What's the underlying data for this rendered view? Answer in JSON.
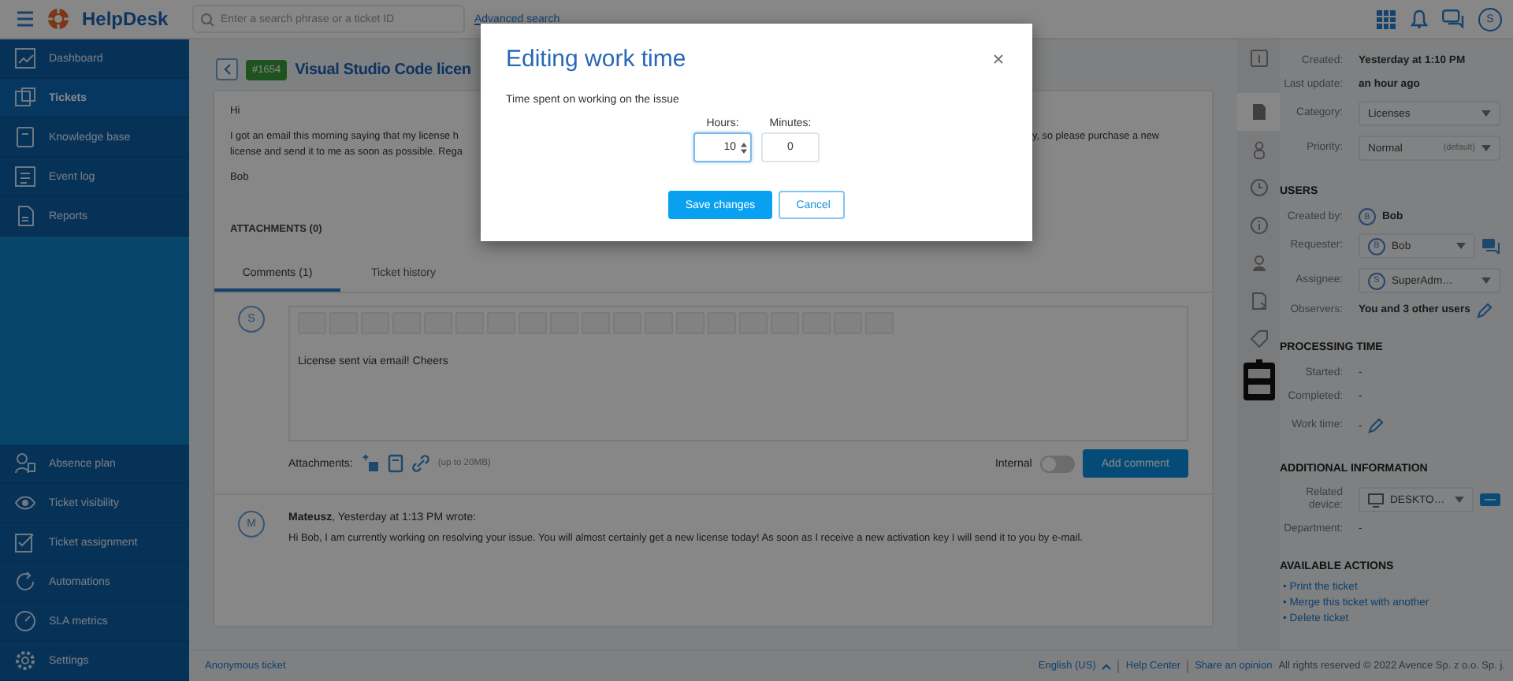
{
  "topbar": {
    "app_name": "HelpDesk",
    "search": {
      "placeholder": "Enter a search phrase or a ticket ID"
    },
    "advanced_search": "Advanced search",
    "avatar": "S"
  },
  "sidebar": {
    "items": [
      {
        "label": "Dashboard",
        "selected": false
      },
      {
        "label": "Tickets",
        "selected": true
      },
      {
        "label": "Knowledge base",
        "selected": false
      },
      {
        "label": "Event log",
        "selected": false
      },
      {
        "label": "Reports",
        "selected": false
      }
    ],
    "bottom_items": [
      {
        "label": "Absence plan",
        "selected": false
      },
      {
        "label": "Ticket visibility",
        "selected": false
      },
      {
        "label": "Ticket assignment",
        "selected": false
      },
      {
        "label": "Automations",
        "selected": false
      },
      {
        "label": "SLA metrics",
        "selected": false
      },
      {
        "label": "Settings",
        "selected": false
      }
    ]
  },
  "ticket": {
    "number": "#1654",
    "title": "Visual Studio Code licen",
    "greeting": "Hi",
    "body_lines": [
      {
        "left": "I got an email this morning saying that my license h",
        "right": "y, so please purchase a new"
      },
      {
        "left": "license and send it to me as soon as possible. Rega"
      }
    ],
    "signature": "Bob",
    "attachments_heading": "ATTACHMENTS (0)",
    "tabs": [
      {
        "label": "Comments (1)",
        "selected": true
      },
      {
        "label": "Ticket history",
        "selected": false
      }
    ],
    "editor": {
      "avatar": "S",
      "text": "License sent via email! Cheers"
    },
    "attachments_label": "Attachments:",
    "attachments_limit": "(up to 20MB)",
    "internal": {
      "label": "Internal",
      "on": false
    },
    "add_comment": "Add comment",
    "comments": [
      {
        "avatar": "M",
        "header": "**Mateusz**, Yesterday at 1:13 PM wrote:",
        "text": "Hi Bob, I am currently working on resolving your issue. You will almost certainly get a new license today! As soon as I receive a new activation key I will send it to you by e-mail."
      }
    ]
  },
  "details": {
    "sections": [
      {
        "fields": [
          {
            "label": "Created:",
            "kind": "info",
            "value": "Yesterday at 1:10 PM"
          },
          {
            "label": "Last update:",
            "kind": "info",
            "value": "an hour ago"
          },
          {
            "label": "Category:",
            "kind": "select",
            "value": "Licenses"
          },
          {
            "label": "Priority:",
            "kind": "select",
            "value": "Normal",
            "note": "(default)"
          }
        ]
      },
      {
        "title": "USERS",
        "fields": [
          {
            "label": "Created by:",
            "kind": "user",
            "avatar": "B",
            "value": "Bob"
          },
          {
            "label": "Requester:",
            "kind": "user_select",
            "avatar": "B",
            "value": "Bob",
            "action": {
              "kind": "chat"
            }
          },
          {
            "label": "Assignee:",
            "kind": "user_select",
            "avatar": "S",
            "value": "SuperAdm…"
          },
          {
            "label": "Observers:",
            "kind": "info",
            "value": "You and 3 other users",
            "action": {
              "kind": "edit"
            }
          }
        ]
      },
      {
        "title": "PROCESSING TIME",
        "fields": [
          {
            "label": "Started:",
            "kind": "text",
            "value": "-"
          },
          {
            "label": "Completed:",
            "kind": "text",
            "value": "-"
          },
          {
            "label": "Work time:",
            "kind": "text",
            "value": "-",
            "action": {
              "kind": "edit"
            }
          }
        ]
      },
      {
        "title": "ADDITIONAL INFORMATION",
        "fields": [
          {
            "label": "Related device:",
            "kind": "device_select",
            "value": "DESKTO…",
            "action": {
              "kind": "tag"
            }
          },
          {
            "label": "Department:",
            "kind": "text",
            "value": "-"
          }
        ]
      }
    ],
    "actions": {
      "title": "AVAILABLE ACTIONS",
      "links": [
        "• Print the ticket",
        "• Merge this ticket with another",
        "• Delete ticket"
      ]
    }
  },
  "footer": {
    "left": "Anonymous ticket",
    "language": "English (US)",
    "links": [
      "Help Center",
      "Share an opinion"
    ],
    "copyright": "All rights reserved © 2022 Avence Sp. z o.o. Sp. j."
  },
  "modal": {
    "title": "Editing work time",
    "description": "Time spent on working on the issue",
    "fields": [
      {
        "label": "Hours:",
        "value": "10",
        "kind": "spinner",
        "focused": true
      },
      {
        "label": "Minutes:",
        "value": "0",
        "kind": "plain",
        "focused": false
      }
    ],
    "buttons": [
      {
        "label": "Save changes",
        "kind": "primary"
      },
      {
        "label": "Cancel",
        "kind": "secondary"
      }
    ]
  }
}
